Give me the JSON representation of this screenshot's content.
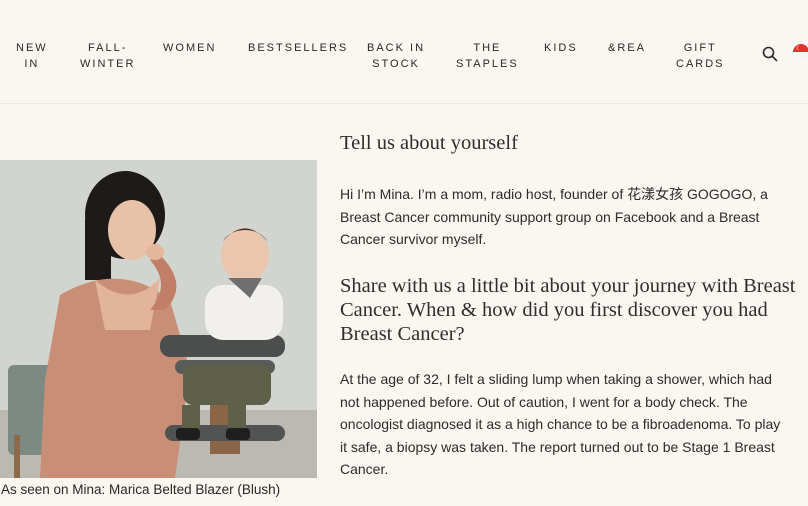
{
  "nav": {
    "items": [
      {
        "label": "NEW\nIN"
      },
      {
        "label": "FALL-\nWINTER"
      },
      {
        "label": "WOMEN"
      },
      {
        "label": "BESTSELLERS"
      },
      {
        "label": "BACK IN\nSTOCK"
      },
      {
        "label": "THE\nSTAPLES"
      },
      {
        "label": "KIDS"
      },
      {
        "label": "&REA"
      },
      {
        "label": "GIFT\nCARDS"
      }
    ],
    "search_icon": "search-icon",
    "region_flag_icon": "singapore-flag-icon"
  },
  "figure": {
    "caption": "As seen on Mina: Marica Belted Blazer (Blush)",
    "colors": {
      "background_wall": "#cfd3cd",
      "outfit": "#c98f76"
    }
  },
  "article": {
    "q1": "Tell us about yourself",
    "a1": "Hi I’m Mina. I’m a mom, radio host, founder of 花漾女孩 GOGOGO, a\nBreast Cancer community support group on Facebook and a Breast\nCancer survivor myself.",
    "q2_line1": "Share with us a little bit about your journey with Breast",
    "q2_line2": "Cancer. When & how did you first discover you had",
    "q2_line3": "Breast Cancer?",
    "a2": "At the age of 32, I felt a sliding lump when taking a shower, which had\nnot happened before. Out of caution, I went for a body check. The\noncologist diagnosed it as a high chance to be a fibroadenoma. To play\nit safe, a biopsy was taken. The report turned out to be Stage 1 Breast\nCancer."
  }
}
